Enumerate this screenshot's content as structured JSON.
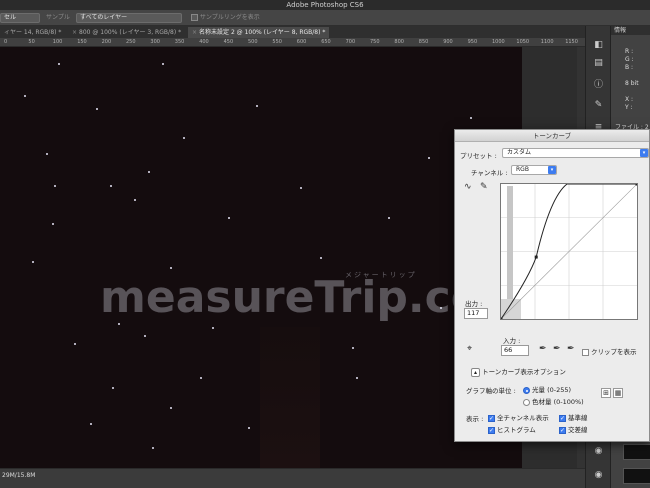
{
  "app": {
    "title": "Adobe Photoshop CS6"
  },
  "options_bar": {
    "select_left": "セル",
    "sample_label": "サンプル",
    "sample_value": "すべてのレイヤー",
    "sampling_ring_label": "サンプルリングを表示"
  },
  "tabs": [
    {
      "label": "ィヤー 14, RGB/8) *",
      "active": false
    },
    {
      "label": "800 @ 100% (レイヤー 3, RGB/8) *",
      "active": false
    },
    {
      "label": "名称未設定 2 @ 100% (レイヤー 8, RGB/8) *",
      "active": true
    }
  ],
  "ruler": [
    "0",
    "50",
    "100",
    "150",
    "200",
    "250",
    "300",
    "350",
    "400",
    "450",
    "500",
    "550",
    "600",
    "650",
    "700",
    "750",
    "800",
    "850",
    "900",
    "950",
    "1000",
    "1050",
    "1100",
    "1150"
  ],
  "watermark": {
    "main": "measureTrip.com",
    "sub": "メジャートリップ"
  },
  "status": {
    "doc_size": "29M/15.8M"
  },
  "info_panel": {
    "header": "情報",
    "r": "R :",
    "g": "G :",
    "b": "B :",
    "bit": "8 bit",
    "x": "X :",
    "y": "Y :",
    "file": "ファイル : 2"
  },
  "dialog": {
    "title": "トーンカーブ",
    "preset_label": "プリセット :",
    "preset_value": "カスタム",
    "channel_label": "チャンネル :",
    "channel_value": "RGB",
    "output_label": "出力 :",
    "output_value": "117",
    "input_label": "入力 :",
    "input_value": "66",
    "clip_label": "クリップを表示",
    "options_label": "トーンカーブ表示オプション",
    "unit_label": "グラフ軸の単位 :",
    "unit_light": "光量 (0-255)",
    "unit_pigment": "色材量 (0-100%)",
    "show_label": "表示 :",
    "show_all_channels": "全チャンネル表示",
    "show_baseline": "基準線",
    "show_histogram": "ヒストグラム",
    "show_intersection": "交差線",
    "accent": "#3d7cf0"
  },
  "curve": {
    "points": [
      [
        0,
        0
      ],
      [
        66,
        117
      ],
      [
        255,
        255
      ]
    ],
    "scale": [
      0,
      255
    ]
  }
}
